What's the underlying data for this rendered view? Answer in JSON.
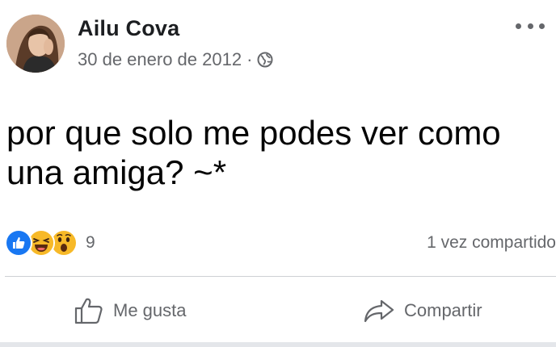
{
  "post": {
    "author": "Ailu Cova",
    "date": "30 de enero de 2012",
    "separator": "·",
    "audience_icon": "globe-icon",
    "text_line1": "por que solo me podes ver como",
    "text_line2": "una amiga? ~*"
  },
  "engagement": {
    "reaction_icons": [
      "like-icon",
      "haha-icon",
      "wow-icon"
    ],
    "reaction_count": "9",
    "shares": "1 vez compartido"
  },
  "actions": {
    "like_label": "Me gusta",
    "share_label": "Compartir"
  },
  "colors": {
    "like_blue": "#1877f2",
    "emoji_yellow": "#f7b928",
    "secondary_text": "#65676b"
  }
}
